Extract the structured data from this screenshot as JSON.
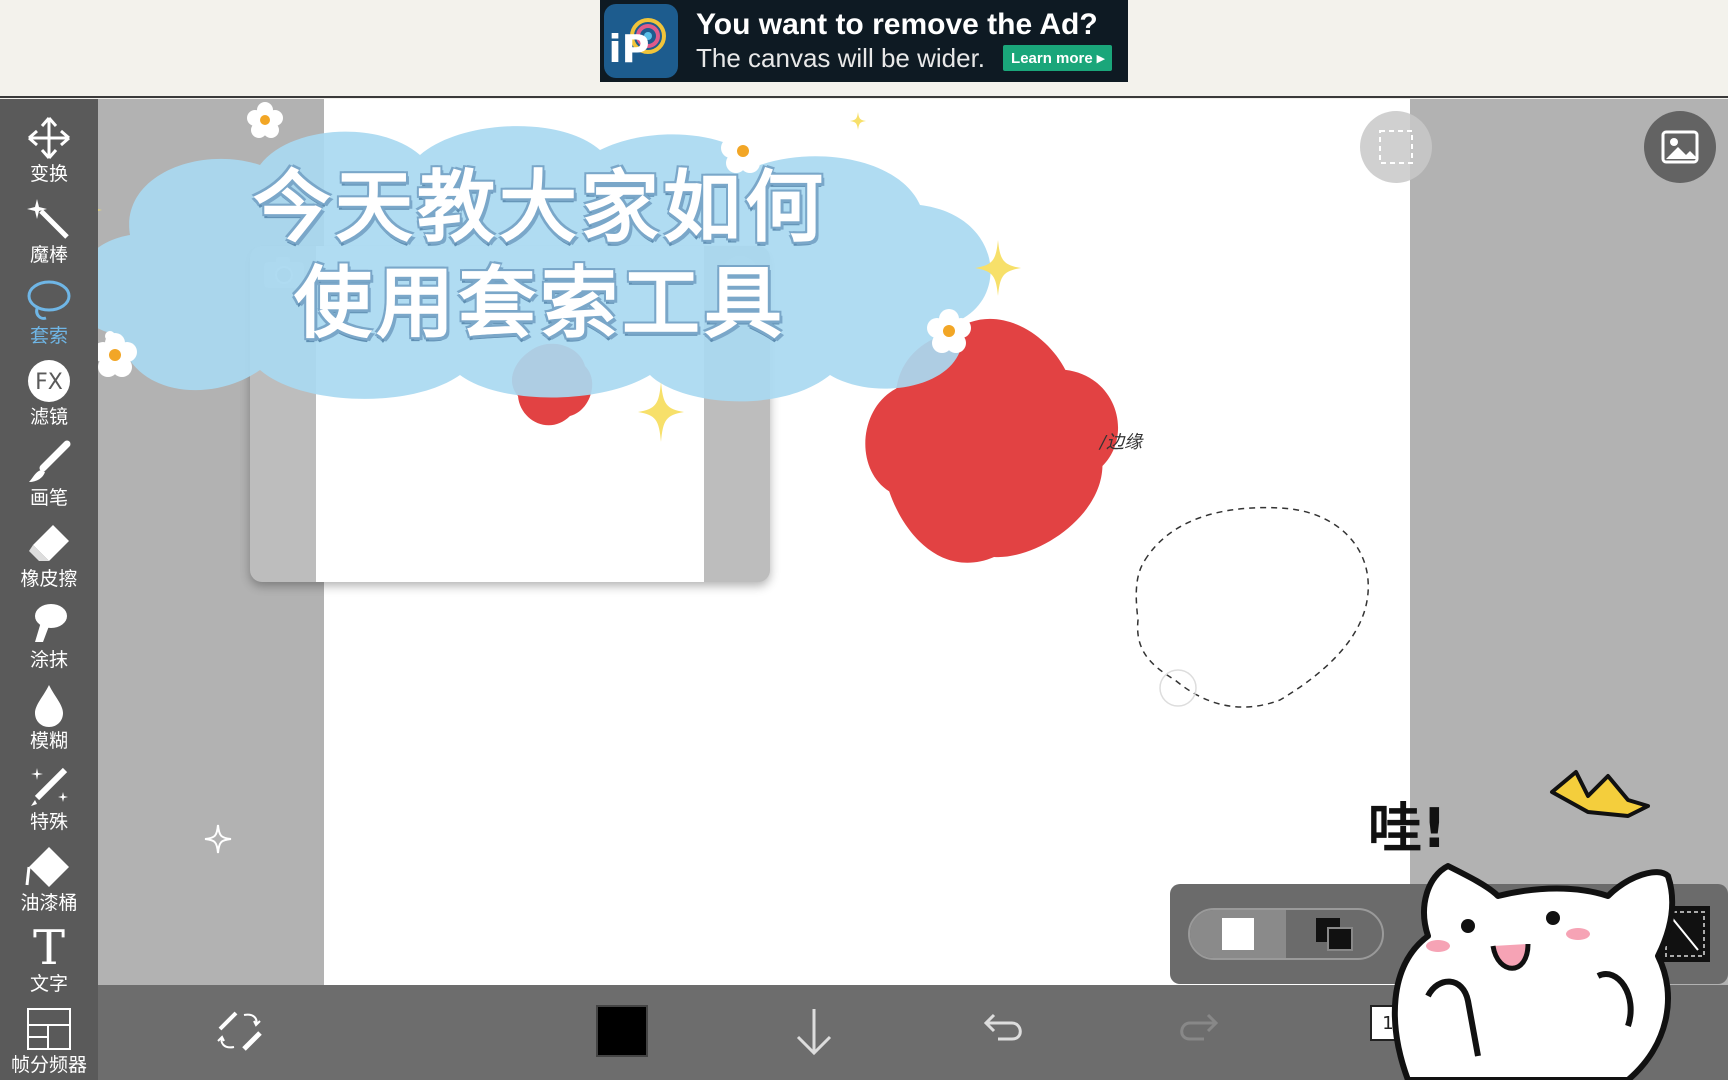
{
  "ad": {
    "logo_text": "iP",
    "title": "You want to remove the Ad?",
    "subtitle": "The canvas will be wider.",
    "button": "Learn more ▸"
  },
  "toolbar": {
    "items": [
      {
        "name": "transform",
        "label": "变换",
        "icon": "move-arrows-icon"
      },
      {
        "name": "magic-wand",
        "label": "魔棒",
        "icon": "magic-wand-icon"
      },
      {
        "name": "lasso",
        "label": "套索",
        "icon": "lasso-icon",
        "active": true
      },
      {
        "name": "filter",
        "label": "滤镜",
        "icon": "fx-icon",
        "icon_text": "FX"
      },
      {
        "name": "brush",
        "label": "画笔",
        "icon": "brush-icon"
      },
      {
        "name": "eraser",
        "label": "橡皮擦",
        "icon": "eraser-icon"
      },
      {
        "name": "smudge",
        "label": "涂抹",
        "icon": "smudge-finger-icon"
      },
      {
        "name": "blur",
        "label": "模糊",
        "icon": "blur-drop-icon"
      },
      {
        "name": "special",
        "label": "特殊",
        "icon": "special-pen-icon"
      },
      {
        "name": "bucket",
        "label": "油漆桶",
        "icon": "paint-bucket-icon"
      },
      {
        "name": "text",
        "label": "文字",
        "icon": "text-icon",
        "icon_text": "T"
      },
      {
        "name": "frame-divider",
        "label": "帧分频器",
        "icon": "frame-divider-icon"
      }
    ],
    "active_color": "#6fb6e6"
  },
  "overlay": {
    "title_line1": "今天教大家如何",
    "title_line2": "使用套索工具",
    "note": "/边缘",
    "exclaim": "哇!"
  },
  "bottom_bar": {
    "page_number": "1",
    "current_color": "#000000"
  },
  "colors": {
    "red_shape": "#e24243",
    "cloud": "#a9d9f1",
    "toolbar_bg": "#5a5a5a"
  }
}
